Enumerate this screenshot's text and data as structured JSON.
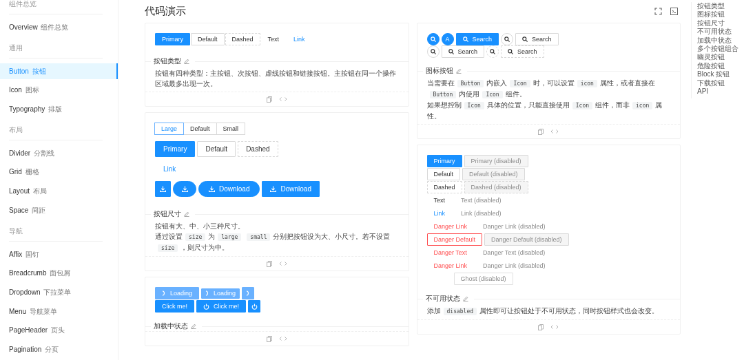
{
  "sidebar": {
    "groups": [
      {
        "title": "组件总览",
        "items": [
          {
            "name": "Overview",
            "sub": "组件总览",
            "selected": false
          }
        ]
      },
      {
        "title": "通用",
        "items": [
          {
            "name": "Button",
            "sub": "按钮",
            "selected": true
          },
          {
            "name": "Icon",
            "sub": "图标",
            "selected": false
          },
          {
            "name": "Typography",
            "sub": "排版",
            "selected": false
          }
        ]
      },
      {
        "title": "布局",
        "items": [
          {
            "name": "Divider",
            "sub": "分割线",
            "selected": false
          },
          {
            "name": "Grid",
            "sub": "栅格",
            "selected": false
          },
          {
            "name": "Layout",
            "sub": "布局",
            "selected": false
          },
          {
            "name": "Space",
            "sub": "间距",
            "selected": false
          }
        ]
      },
      {
        "title": "导航",
        "items": [
          {
            "name": "Affix",
            "sub": "固钉",
            "selected": false
          },
          {
            "name": "Breadcrumb",
            "sub": "面包屑",
            "selected": false
          },
          {
            "name": "Dropdown",
            "sub": "下拉菜单",
            "selected": false
          },
          {
            "name": "Menu",
            "sub": "导航菜单",
            "selected": false
          },
          {
            "name": "PageHeader",
            "sub": "页头",
            "selected": false
          },
          {
            "name": "Pagination",
            "sub": "分页",
            "selected": false
          }
        ]
      }
    ]
  },
  "page_title": "代码演示",
  "columns": [
    {
      "cards": [
        {
          "kind": "types",
          "title": "按钮类型",
          "rows": [
            {
              "buttons": [
                {
                  "kind": "primary",
                  "label": "Primary"
                },
                {
                  "kind": "default",
                  "label": "Default"
                },
                {
                  "kind": "dashed",
                  "label": "Dashed"
                },
                {
                  "kind": "text",
                  "label": "Text"
                },
                {
                  "kind": "link",
                  "label": "Link"
                }
              ]
            }
          ],
          "description": [
            [
              {
                "kind": "text",
                "text": "按钮有四种类型：主按钮、次按钮、虚线按钮和链接按钮。主按钮在同一个操作区域最多出现一次。"
              }
            ]
          ]
        },
        {
          "kind": "size",
          "title": "按钮尺寸",
          "size_picker": [
            {
              "label": "Large",
              "selected": true
            },
            {
              "label": "Default",
              "selected": false
            },
            {
              "label": "Small",
              "selected": false
            }
          ],
          "rows": [
            {
              "buttons": [
                {
                  "kind": "primary",
                  "label": "Primary",
                  "large": true,
                  "icon": false
                },
                {
                  "kind": "default",
                  "label": "Default",
                  "large": true,
                  "icon": false
                },
                {
                  "kind": "dashed",
                  "label": "Dashed",
                  "large": true,
                  "icon": false
                }
              ]
            },
            {
              "buttons": [
                {
                  "kind": "link",
                  "label": "Link",
                  "large": true,
                  "icon": false
                }
              ]
            },
            {
              "buttons": [
                {
                  "kind": "primary",
                  "large": true,
                  "icon": true
                },
                {
                  "kind": "primary",
                  "large": true,
                  "round": true,
                  "icon": true
                },
                {
                  "kind": "primary",
                  "label": "Download",
                  "large": true,
                  "round": true,
                  "icon": true
                },
                {
                  "kind": "primary",
                  "label": "Download",
                  "large": true,
                  "icon": true
                }
              ]
            }
          ],
          "description": [
            [
              {
                "kind": "text",
                "text": "按钮有大、中、小三种尺寸。"
              }
            ],
            [
              {
                "kind": "text",
                "text": "通过设置"
              },
              {
                "kind": "code",
                "text": "size"
              },
              {
                "kind": "text",
                "text": "为"
              },
              {
                "kind": "code",
                "text": "large"
              },
              {
                "kind": "code",
                "text": "small"
              },
              {
                "kind": "text",
                "text": "分别把按钮设为大、小尺寸。若不设置"
              },
              {
                "kind": "code",
                "text": "size"
              },
              {
                "kind": "text",
                "text": "，则尺寸为中。"
              }
            ]
          ]
        },
        {
          "kind": "loading",
          "title": "加载中状态",
          "rows": [
            {
              "buttons": [
                {
                  "kind": "primary",
                  "label": "Loading",
                  "loading": true,
                  "icon": true
                },
                {
                  "kind": "primary",
                  "label": "Loading",
                  "small": true,
                  "loading": true,
                  "icon": true
                },
                {
                  "kind": "primary",
                  "loading": true,
                  "icon": true
                }
              ]
            },
            {
              "buttons": [
                {
                  "kind": "primary",
                  "label": "Click me!",
                  "loading": false,
                  "icon": false
                },
                {
                  "kind": "primary",
                  "label": "Click me!",
                  "loading": false,
                  "icon": true
                },
                {
                  "kind": "primary",
                  "loading": false,
                  "icon": true
                }
              ]
            }
          ]
        }
      ]
    },
    {
      "cards": [
        {
          "kind": "icon",
          "title": "图标按钮",
          "rows": [
            {
              "buttons": [
                {
                  "kind": "primary",
                  "circle": true,
                  "icon": true
                },
                {
                  "kind": "primary",
                  "circle": true,
                  "label": "A",
                  "icon": false
                },
                {
                  "kind": "primary",
                  "label": "Search",
                  "icon": true
                },
                {
                  "kind": "default",
                  "circle": true,
                  "icon": true
                },
                {
                  "kind": "default",
                  "label": "Search",
                  "icon": true
                }
              ]
            },
            {
              "buttons": [
                {
                  "kind": "default",
                  "circle": true,
                  "icon": true
                },
                {
                  "kind": "default",
                  "label": "Search",
                  "icon": true
                },
                {
                  "kind": "dashed",
                  "circle": true,
                  "icon": true
                },
                {
                  "kind": "dashed",
                  "label": "Search",
                  "icon": true
                }
              ]
            }
          ],
          "description": [
            [
              {
                "kind": "text",
                "text": "当需要在"
              },
              {
                "kind": "code",
                "text": "Button"
              },
              {
                "kind": "text",
                "text": "内嵌入"
              },
              {
                "kind": "code",
                "text": "Icon"
              },
              {
                "kind": "text",
                "text": "时，可以设置"
              },
              {
                "kind": "code",
                "text": "icon"
              },
              {
                "kind": "text",
                "text": "属性，或者直接在"
              },
              {
                "kind": "code",
                "text": "Button"
              },
              {
                "kind": "text",
                "text": "内使用"
              },
              {
                "kind": "code",
                "text": "Icon"
              },
              {
                "kind": "text",
                "text": "组件。"
              }
            ],
            [
              {
                "kind": "text",
                "text": "如果想控制"
              },
              {
                "kind": "code",
                "text": "Icon"
              },
              {
                "kind": "text",
                "text": "具体的位置，只能直接使用"
              },
              {
                "kind": "code",
                "text": "Icon"
              },
              {
                "kind": "text",
                "text": "组件，而非"
              },
              {
                "kind": "code",
                "text": "icon"
              },
              {
                "kind": "text",
                "text": "属性。"
              }
            ]
          ]
        },
        {
          "kind": "disabled",
          "title": "不可用状态",
          "rows": [
            {
              "buttons": [
                {
                  "kind": "primary",
                  "label": "Primary",
                  "disabled": false,
                  "danger": false
                },
                {
                  "kind": "primary",
                  "label": "Primary (disabled)",
                  "disabled": true
                }
              ]
            },
            {
              "buttons": [
                {
                  "kind": "default",
                  "label": "Default",
                  "disabled": false,
                  "danger": false
                },
                {
                  "kind": "default",
                  "label": "Default (disabled)",
                  "disabled": true
                }
              ]
            },
            {
              "buttons": [
                {
                  "kind": "dashed",
                  "label": "Dashed",
                  "disabled": false,
                  "danger": false
                },
                {
                  "kind": "dashed",
                  "label": "Dashed (disabled)",
                  "disabled": true
                }
              ]
            },
            {
              "buttons": [
                {
                  "kind": "text",
                  "label": "Text",
                  "disabled": false,
                  "danger": false
                },
                {
                  "kind": "text",
                  "label": "Text (disabled)",
                  "disabled": true
                }
              ]
            },
            {
              "buttons": [
                {
                  "kind": "link",
                  "label": "Link",
                  "disabled": false,
                  "danger": false
                },
                {
                  "kind": "link",
                  "label": "Link (disabled)",
                  "disabled": true
                }
              ]
            },
            {
              "buttons": [
                {
                  "kind": "link",
                  "label": "Danger Link",
                  "disabled": false,
                  "danger": true
                },
                {
                  "kind": "link",
                  "label": "Danger Link (disabled)",
                  "disabled": true
                }
              ]
            },
            {
              "buttons": [
                {
                  "kind": "default",
                  "label": "Danger Default",
                  "disabled": false,
                  "danger": true
                },
                {
                  "kind": "default",
                  "label": "Danger Default (disabled)",
                  "disabled": true
                }
              ]
            },
            {
              "buttons": [
                {
                  "kind": "text",
                  "label": "Danger Text",
                  "disabled": false,
                  "danger": true
                },
                {
                  "kind": "text",
                  "label": "Danger Text (disabled)",
                  "disabled": true
                }
              ]
            },
            {
              "buttons": [
                {
                  "kind": "link",
                  "label": "Danger Link",
                  "disabled": false,
                  "danger": true
                },
                {
                  "kind": "link",
                  "label": "Danger Link (disabled)",
                  "disabled": true
                }
              ]
            },
            {
              "buttons": [
                {
                  "kind": "ghost",
                  "label": "Ghost (disabled)",
                  "disabled": true
                }
              ]
            }
          ],
          "description": [
            [
              {
                "kind": "text",
                "text": "添加"
              },
              {
                "kind": "code",
                "text": "disabled"
              },
              {
                "kind": "text",
                "text": "属性即可让按钮处于不可用状态，同时按钮样式也会改变。"
              }
            ]
          ]
        }
      ]
    }
  ],
  "anchor_links": [
    "按钮类型",
    "图标按钮",
    "按钮尺寸",
    "不可用状态",
    "加载中状态",
    "多个按钮组合",
    "幽灵按钮",
    "危险按钮",
    "Block 按钮",
    "下载按钮",
    "API"
  ]
}
